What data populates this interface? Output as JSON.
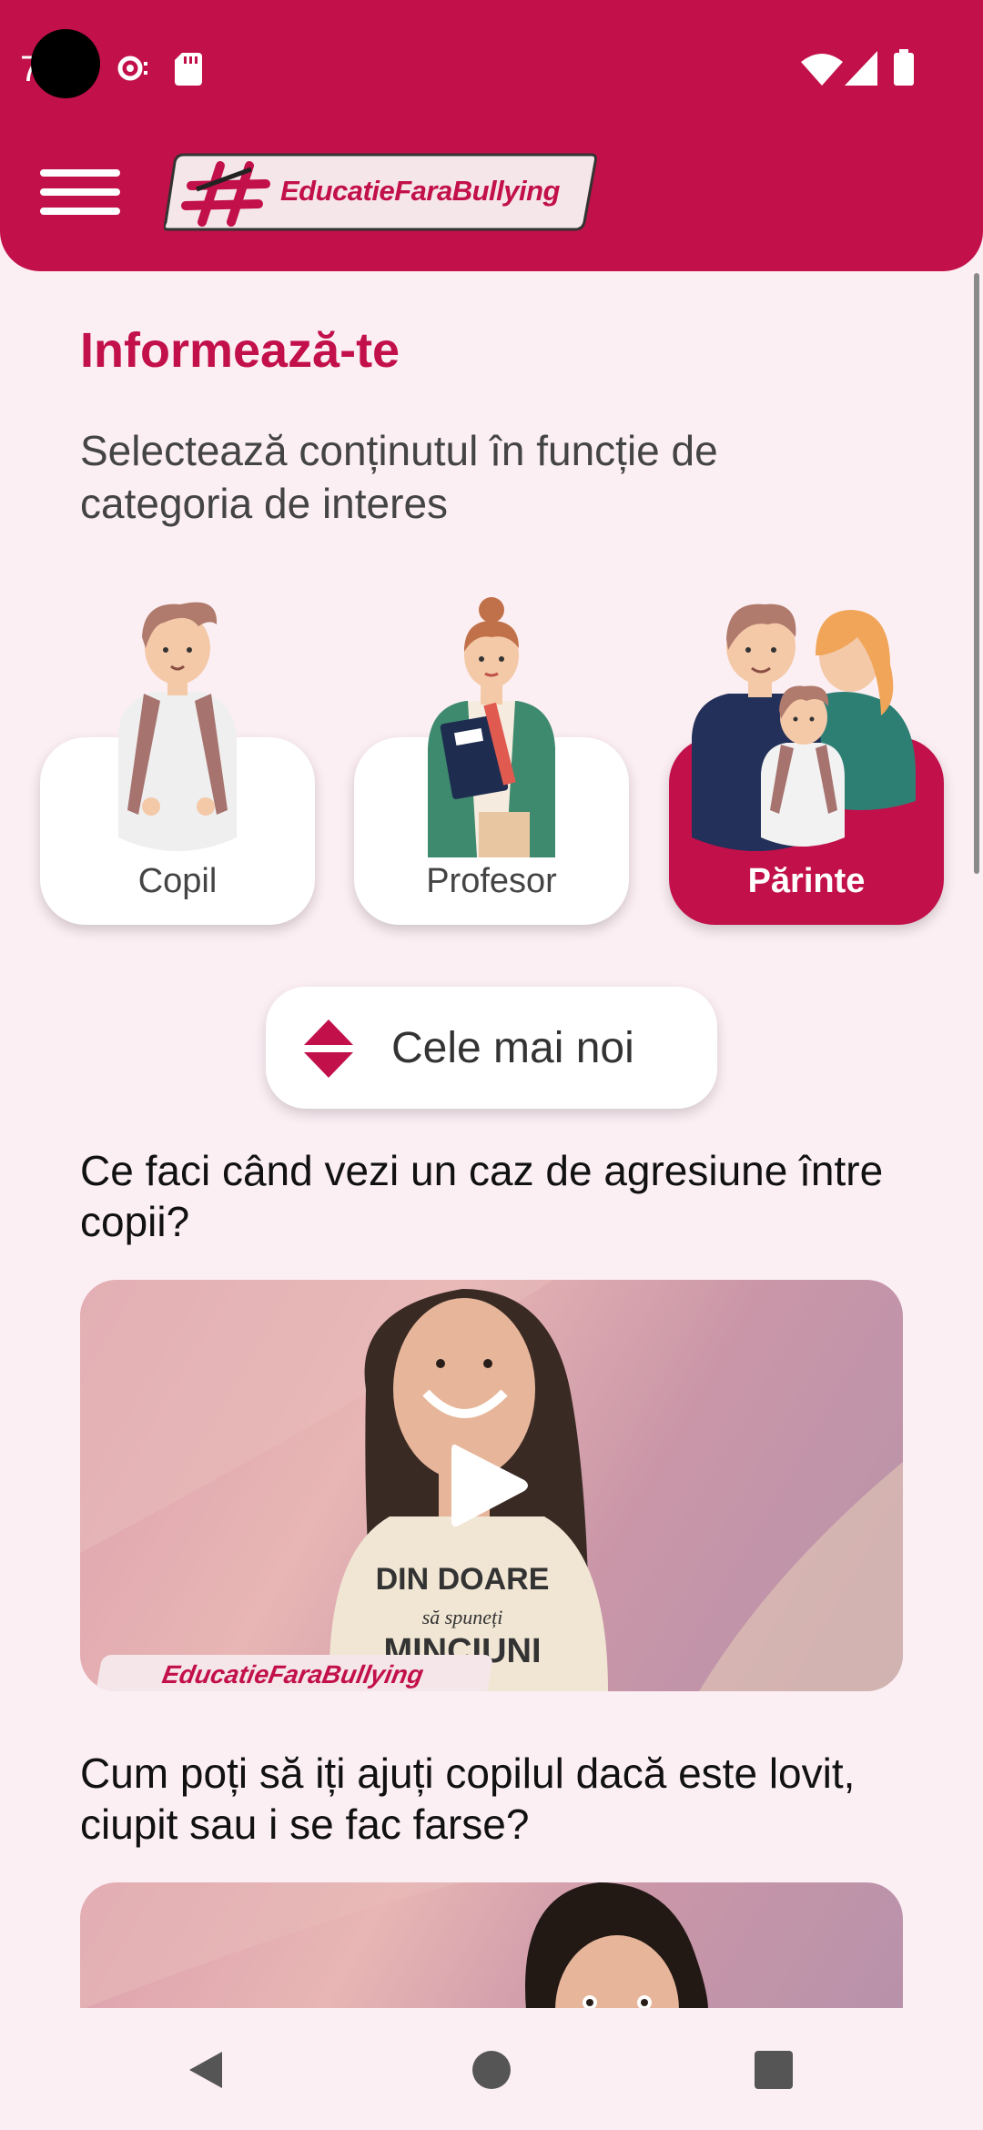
{
  "status_bar": {
    "time": "7"
  },
  "header": {
    "logo_text": "EducatieFaraBullying"
  },
  "page": {
    "title": "Informează-te",
    "subtitle": "Selectează conținutul în funcție de categoria de interes"
  },
  "categories": [
    {
      "label": "Copil",
      "active": false
    },
    {
      "label": "Profesor",
      "active": false
    },
    {
      "label": "Părinte",
      "active": true
    }
  ],
  "sort": {
    "label": "Cele mai noi"
  },
  "articles": [
    {
      "title": "Ce faci când vezi un caz de agresiune între copii?",
      "video_logo_text": "EducatieFaraBullying",
      "shirt_text": [
        "DIN DOARE",
        "să spuneți",
        "MINCIUNI"
      ]
    },
    {
      "title": "Cum poți să iți ajuți copilul dacă este lovit, ciupit sau i se fac farse?"
    }
  ],
  "colors": {
    "brand": "#C2104A",
    "background": "#FCEFF4"
  }
}
